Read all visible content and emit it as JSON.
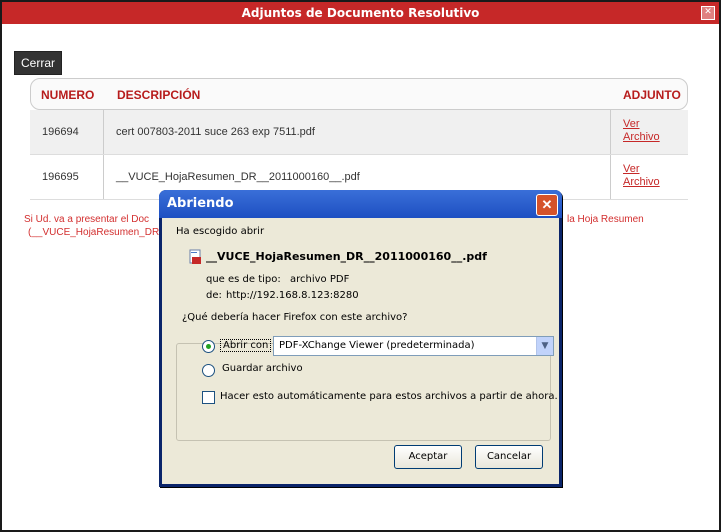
{
  "window": {
    "title": "Adjuntos de Documento Resolutivo",
    "close_icon": "x-icon"
  },
  "cerrar_label": "Cerrar",
  "table": {
    "headers": [
      "NUMERO",
      "DESCRIPCIÓN",
      "ADJUNTO"
    ],
    "rows": [
      {
        "numero": "196694",
        "descripcion": "cert 007803-2011 suce 263 exp 7511.pdf",
        "link1": "Ver",
        "link2": "Archivo"
      },
      {
        "numero": "196695",
        "descripcion": "__VUCE_HojaResumen_DR__2011000160__.pdf",
        "link1": "Ver",
        "link2": "Archivo"
      }
    ]
  },
  "message": {
    "line1_left": "Si Ud. va a presentar el Doc",
    "line1_right": "la Hoja Resumen",
    "line2_left": "(__VUCE_HojaResumen_DR"
  },
  "dialog": {
    "title": "Abriendo  __VUCE_HojaResumen_DR__2011000160__.pdf",
    "chose": "Ha escogido abrir",
    "filename": "__VUCE_HojaResumen_DR__2011000160__.pdf",
    "type_label": "que es de tipo:",
    "type_value": "archivo PDF",
    "from_label": "de:",
    "from_value": "http://192.168.8.123:8280",
    "question": "¿Qué debería hacer Firefox con este archivo?",
    "open_with": "Abrir con",
    "app": "PDF-XChange Viewer (predeterminada)",
    "save": "Guardar archivo",
    "auto": "Hacer esto automáticamente para estos archivos a partir de ahora.",
    "accept": "Aceptar",
    "cancel": "Cancelar"
  }
}
